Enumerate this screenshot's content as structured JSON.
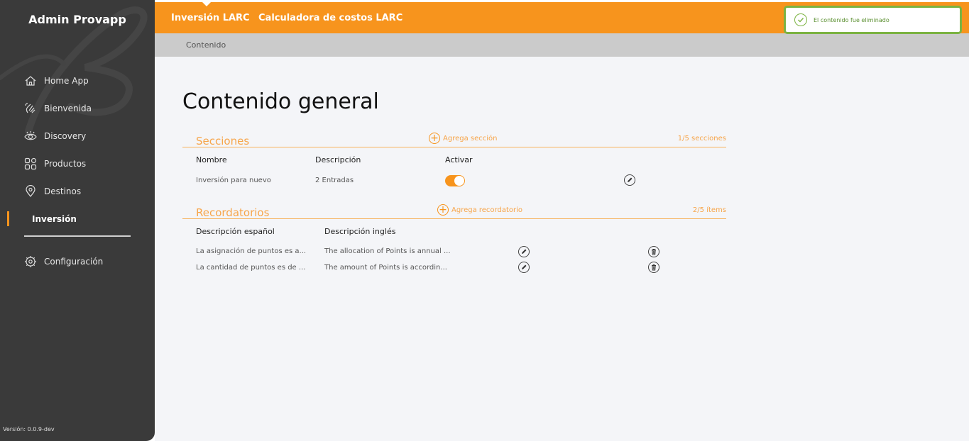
{
  "app": {
    "brand": "Admin Provapp",
    "version": "Versión: 0.0.9-dev"
  },
  "sidebar": {
    "items": [
      {
        "label": "Home App",
        "icon": "home-icon"
      },
      {
        "label": "Bienvenida",
        "icon": "wave-hand-icon"
      },
      {
        "label": "Discovery",
        "icon": "eye-icon"
      },
      {
        "label": "Productos",
        "icon": "grid-icon"
      },
      {
        "label": "Destinos",
        "icon": "location-pin-icon"
      },
      {
        "label": "Inversión",
        "icon": "",
        "active": true
      }
    ],
    "config": {
      "label": "Configuración",
      "icon": "gear-icon"
    }
  },
  "topbar": {
    "tabs": [
      "Inversión LARC",
      "Calculadora de costos LARC"
    ],
    "active_tab": 0
  },
  "breadcrumb": {
    "label": "Contenido"
  },
  "page": {
    "title": "Contenido general"
  },
  "secciones": {
    "title": "Secciones",
    "add_label": "Agrega sección",
    "count": "1/5 secciones",
    "columns": [
      "Nombre",
      "Descripción",
      "Activar"
    ],
    "rows": [
      {
        "nombre": "Inversión para nuevo",
        "descripcion": "2 Entradas",
        "activo": true
      }
    ]
  },
  "recordatorios": {
    "title": "Recordatorios",
    "add_label": "Agrega recordatorio",
    "count": "2/5 ítems",
    "columns": [
      "Descripción español",
      "Descripción inglés"
    ],
    "rows": [
      {
        "es": "La asignación de puntos es a...",
        "en": "The allocation of Points is annual ..."
      },
      {
        "es": "La cantidad de puntos es de ...",
        "en": "The amount of Points is accordin..."
      }
    ]
  },
  "toast": {
    "message": "El contenido fue eliminado",
    "icon": "check-circle-icon"
  },
  "colors": {
    "accent": "#f7941d",
    "sidebar": "#3a3a3a",
    "success": "#7cb342"
  }
}
